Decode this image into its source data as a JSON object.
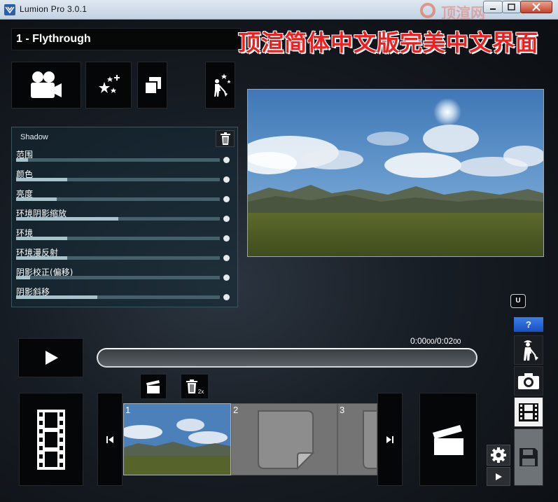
{
  "window": {
    "title": "Lumion Pro  3.0.1",
    "watermark": "顶渲网"
  },
  "project": {
    "name": "1 - Flythrough"
  },
  "banner": {
    "text": "顶渲简体中文版完美中文界面"
  },
  "effect_panel": {
    "title": "Shadow",
    "sliders": [
      {
        "label": "范围",
        "value": 0.06
      },
      {
        "label": "颜色",
        "value": 0.25
      },
      {
        "label": "亮度",
        "value": 0.2
      },
      {
        "label": "环境阴影缩放",
        "value": 0.5
      },
      {
        "label": "环境",
        "value": 0.25
      },
      {
        "label": "环境漫反射",
        "value": 0.25
      },
      {
        "label": "阴影校正(偏移)",
        "value": 0.07
      },
      {
        "label": "阴影斜移",
        "value": 0.4
      }
    ]
  },
  "timeline": {
    "time_main": "0:00",
    "time_sub1": "00",
    "time_sep": "/0:02",
    "time_sub2": "00",
    "delete_clip_suffix": "2x",
    "clips": [
      "1",
      "2",
      "3"
    ]
  },
  "side": {
    "u_label": "U",
    "help_label": "?"
  },
  "colors": {
    "banner": "#f21d1d",
    "help_button": "#2a63d6",
    "accent_panel": "#142a34"
  }
}
